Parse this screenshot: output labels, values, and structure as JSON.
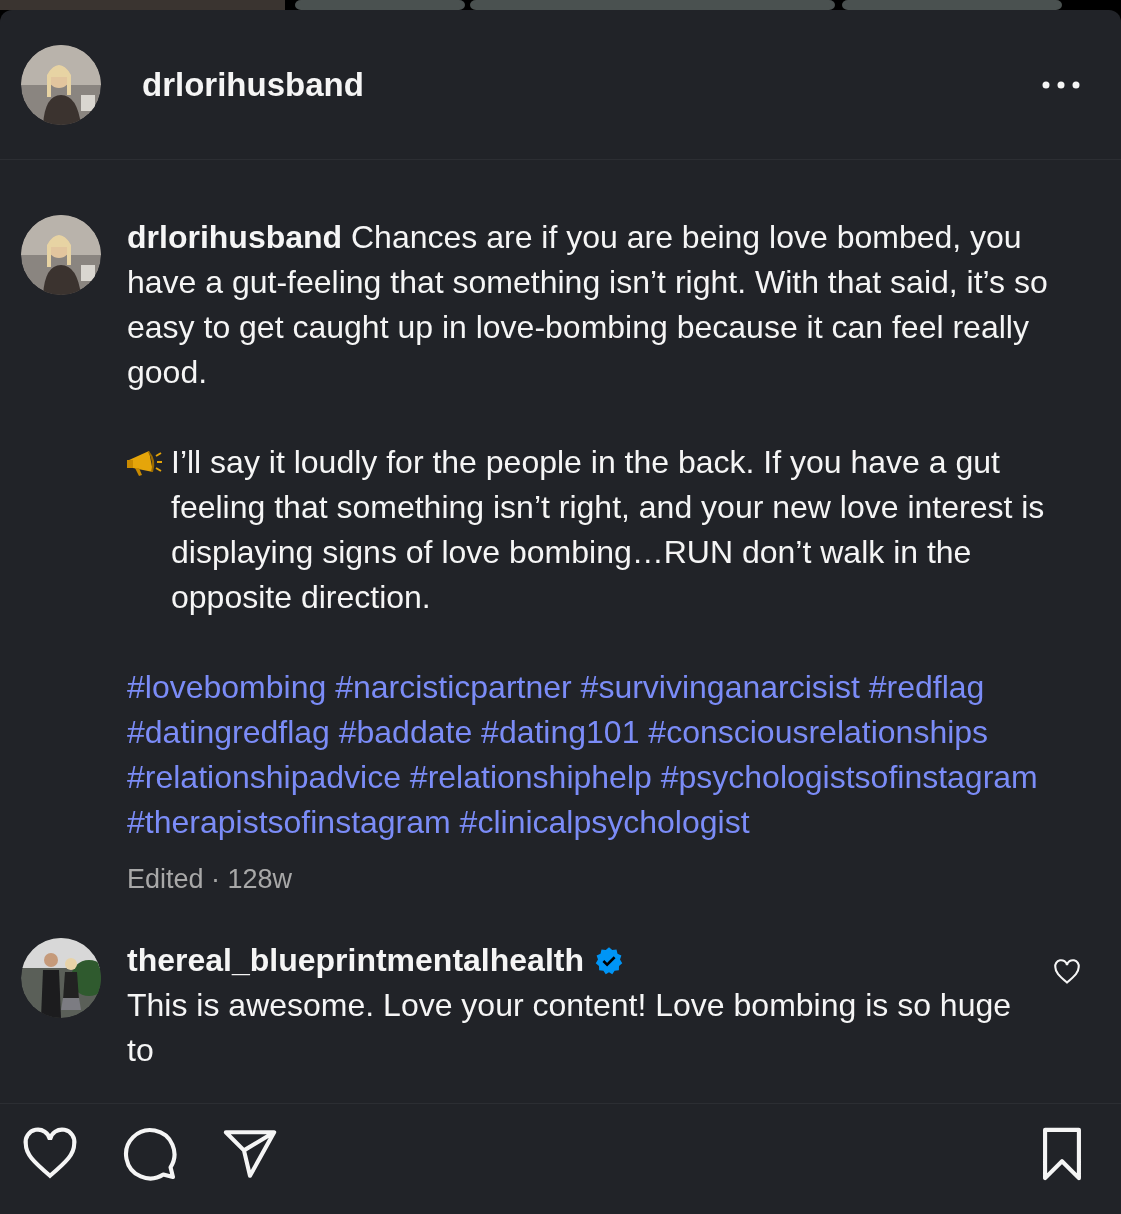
{
  "post_header": {
    "username": "drlorihusband"
  },
  "caption": {
    "paragraphs": [
      {
        "kind": "text",
        "text": "**drlorihusband** Chances are if you are being love bombed, you have a gut-feeling that something isn’t right. With that said, it’s so easy to get caught up in love-bombing because it can feel really good."
      },
      {
        "kind": "megaphone",
        "text": "I’ll say it loudly for the people in the back. If you have a gut feeling that something isn’t right, and your new love interest is displaying signs of love bombing…RUN don’t walk in the opposite direction."
      }
    ],
    "hashtags": [
      "#lovebombing",
      "#narcisticpartner",
      "#survivinganarcisist",
      "#redflag",
      "#datingredflag",
      "#baddate",
      "#dating101",
      "#consciousrelationships",
      "#relationshipadvice",
      "#relationshiphelp",
      "#psychologistsofinstagram",
      "#therapistsofinstagram",
      "#clinicalpsychologist"
    ],
    "meta": "Edited · 128w"
  },
  "comments": [
    {
      "username": "thereal_blueprintmentalhealth",
      "verified": true,
      "text": "This is awesome. Love your content! Love bombing is so huge to",
      "liked": false
    }
  ],
  "actions": {
    "liked": false,
    "saved": false
  }
}
